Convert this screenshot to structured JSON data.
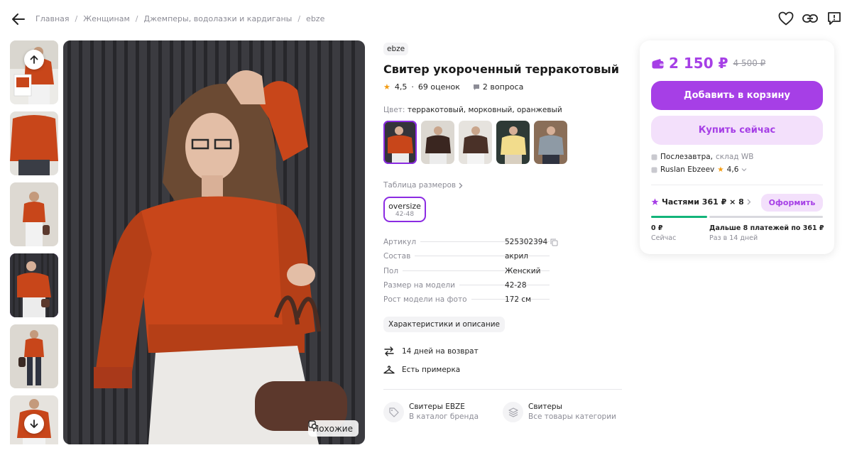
{
  "breadcrumb": [
    "Главная",
    "Женщинам",
    "Джемперы, водолазки и кардиганы",
    "ebze"
  ],
  "product": {
    "brand": "ebze",
    "title": "Свитер укороченный терракотовый",
    "rating": "4,5",
    "reviews": "69 оценок",
    "questions": "2 вопроса",
    "color_label": "Цвет:",
    "color_value": "терракотовый, морковный, оранжевый",
    "size_table": "Таблица размеров",
    "size": {
      "name": "oversize",
      "range": "42-48"
    },
    "similar_label": "Похожие"
  },
  "specs": [
    {
      "key": "Артикул",
      "value": "525302394"
    },
    {
      "key": "Состав",
      "value": "акрил"
    },
    {
      "key": "Пол",
      "value": "Женский"
    },
    {
      "key": "Размер на модели",
      "value": "42-28"
    },
    {
      "key": "Рост модели на фото",
      "value": "172 см"
    }
  ],
  "chars_button": "Характеристики и описание",
  "features": [
    {
      "icon": "return-arrows-icon",
      "text": "14 дней на возврат"
    },
    {
      "icon": "hanger-icon",
      "text": "Есть примерка"
    }
  ],
  "links": [
    {
      "icon": "tag-icon",
      "title": "Свитеры EBZE",
      "subtitle": "В каталог бренда"
    },
    {
      "icon": "layers-icon",
      "title": "Свитеры",
      "subtitle": "Все товары категории"
    }
  ],
  "buy": {
    "price": "2 150 ₽",
    "old_price": "4 500 ₽",
    "add_to_cart": "Добавить в корзину",
    "buy_now": "Купить сейчас",
    "delivery": "Послезавтра,",
    "warehouse": "склад WB",
    "seller": "Ruslan Ebzeev",
    "seller_rating": "4,6",
    "installment": "Частями 361 ₽ × 8",
    "apply": "Оформить",
    "now_amount": "0 ₽",
    "now_label": "Сейчас",
    "later_amount": "Дальше 8 платежей по 361 ₽",
    "later_label": "Раз в 14 дней",
    "paid_fraction": 0.33
  },
  "colors": {
    "accent": "#a63fe6",
    "selection": "#8b2be2",
    "sweater": "#c8461a",
    "star": "#f39c12"
  }
}
